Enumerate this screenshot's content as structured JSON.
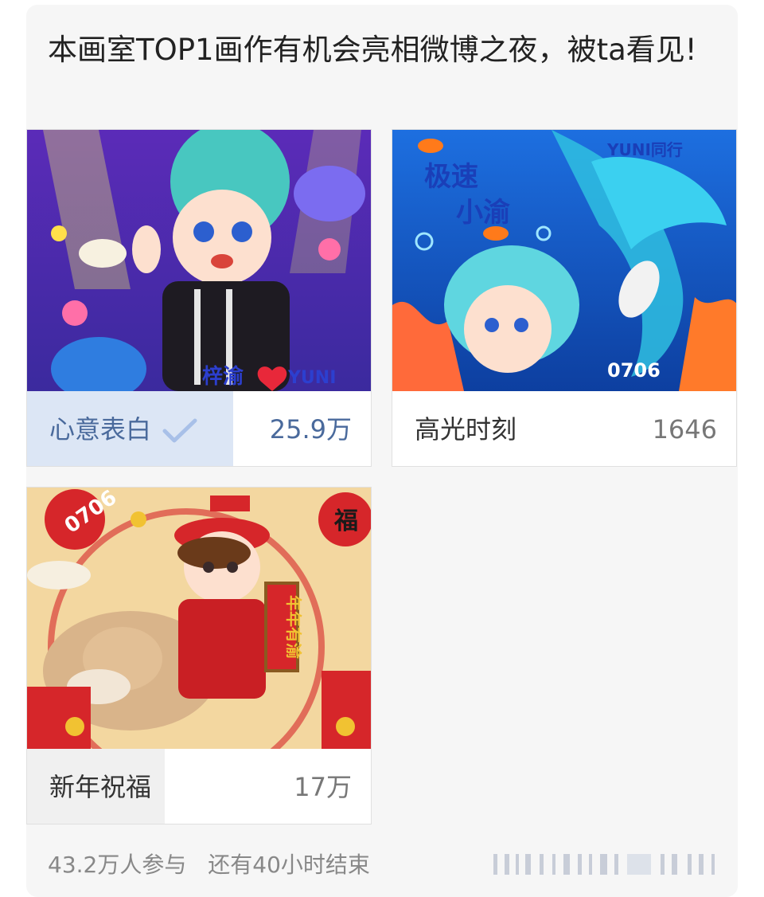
{
  "poll": {
    "title": "本画室TOP1画作有机会亮相微博之夜，被ta看见!",
    "options": [
      {
        "label": "心意表白",
        "count": "25.9万",
        "selected": true,
        "fill_fraction": 0.6,
        "art_text": [
          "梓渝",
          "YUNI"
        ]
      },
      {
        "label": "高光时刻",
        "count": "1646",
        "selected": false,
        "fill_fraction": 0.0,
        "art_text": [
          "极速",
          "小渝",
          "YUNI同行",
          "0706"
        ]
      },
      {
        "label": "新年祝福",
        "count": "17万",
        "selected": false,
        "fill_fraction": 0.4,
        "art_text": [
          "0706",
          "福",
          "年年有渝"
        ]
      }
    ],
    "footer": {
      "participants": "43.2万人参与",
      "remaining": "还有40小时结束"
    }
  },
  "colors": {
    "selected_fill": "#dce6f5",
    "plain_fill": "#f0f0f0",
    "accent": "#4a6a9c"
  },
  "icons": {
    "selected": "check-icon"
  }
}
